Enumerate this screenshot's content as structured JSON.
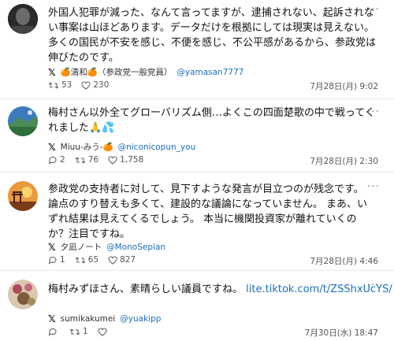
{
  "posts": [
    {
      "text": "外国人犯罪が減った、なんて言ってますが、逮捕されない、起訴されない事案は山ほどあります。データだけを根拠にしては現実は見えない。多くの国民が不安を感じ、不便を感じ、不公平感があるから、参政党は伸びたのです。",
      "display_name": "🍊清和🍊（参政党一般党員）",
      "handle": "@yamasan7777",
      "replies": "",
      "retweets": "53",
      "likes": "230",
      "date": "7月28日(月) 9:02"
    },
    {
      "text": "梅村さん以外全てグローバリズム側…よくこの四面楚歌の中で戦ってくれました🙏💦",
      "display_name": "Miuu-みう-🍊",
      "handle": "@niconicopun_you",
      "replies": "2",
      "retweets": "76",
      "likes": "1,758",
      "date": "7月28日(月) 2:30"
    },
    {
      "text": "参政党の支持者に対して、見下すような発言が目立つのが残念です。 論点のすり替えも多くて、建設的な議論になっていません。 まあ、いずれ結果は見えてくるでしょう。 本当に機関投資家が離れていくのか？注目ですね。",
      "display_name": "夕凪ノート",
      "handle": "@MonoSepian",
      "replies": "1",
      "retweets": "65",
      "likes": "827",
      "date": "7月28日(月) 4:46"
    },
    {
      "text": "梅村みずほさん、素晴らしい議員ですね。",
      "link": "lite.tiktok.com/t/ZSShxUcYS/",
      "display_name": "sumikakumei",
      "handle": "@yuakipp",
      "replies": "",
      "retweets": "1",
      "likes": "",
      "date": "7月30日(水) 18:47"
    }
  ],
  "menu_glyph": "···",
  "x_logo": "𝕏"
}
